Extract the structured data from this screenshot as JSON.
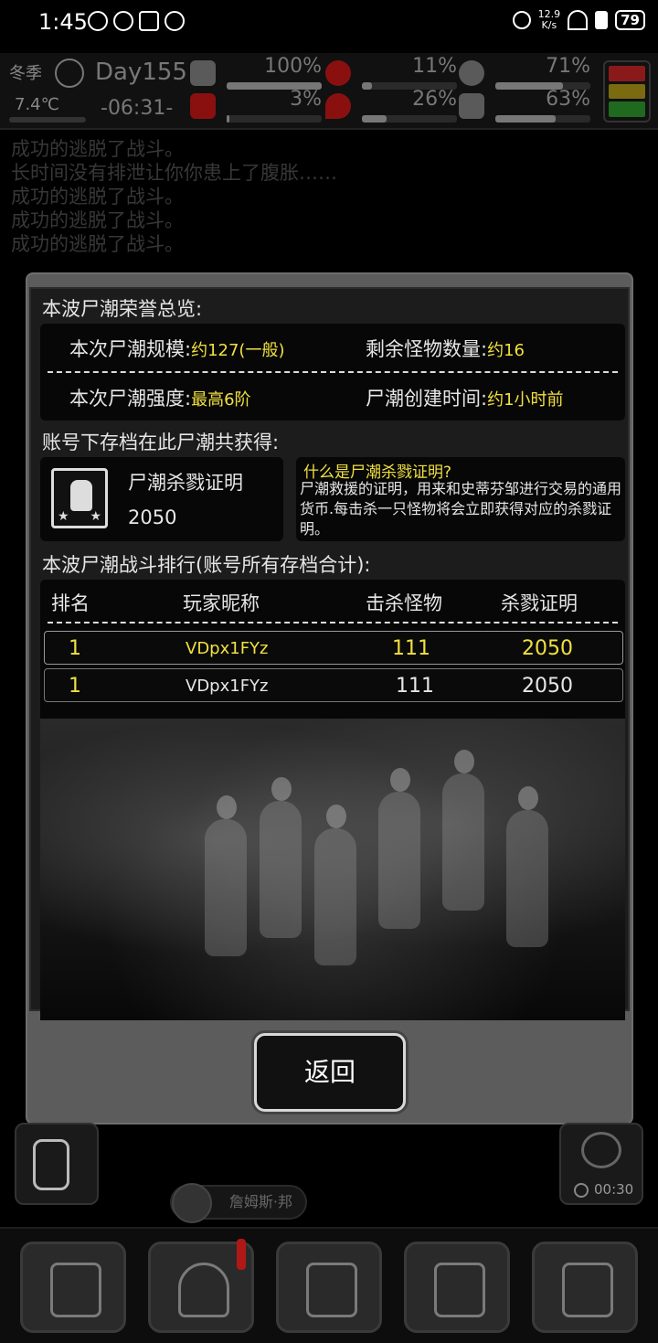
{
  "status_bar": {
    "time": "1:45",
    "net_speed": "12.9",
    "net_unit": "K/s",
    "battery": "79"
  },
  "hud": {
    "season": "冬季",
    "temperature": "7.4℃",
    "day": "Day155",
    "clock": "-06:31-",
    "stats": [
      {
        "name": "health",
        "value": "100%",
        "fill": 1.0
      },
      {
        "name": "hunger",
        "value": "11%",
        "fill": 0.11
      },
      {
        "name": "stamina",
        "value": "71%",
        "fill": 0.71
      },
      {
        "name": "toilet",
        "value": "3%",
        "fill": 0.03
      },
      {
        "name": "thirst",
        "value": "26%",
        "fill": 0.26
      },
      {
        "name": "mood",
        "value": "63%",
        "fill": 0.63
      }
    ],
    "alert_colors": [
      "#8a1a1a",
      "#7a6a10",
      "#1f6a1f"
    ]
  },
  "log": [
    "成功的逃脱了战斗。",
    "长时间没有排泄让你你患上了腹胀……",
    "成功的逃脱了战斗。",
    "成功的逃脱了战斗。",
    "成功的逃脱了战斗。"
  ],
  "modal": {
    "overview_title": "本波尸潮荣誉总览:",
    "scale_label": "本次尸潮规模:",
    "scale_value": "约127(一般)",
    "remaining_label": "剩余怪物数量:",
    "remaining_value": "约16",
    "intensity_label": "本次尸潮强度:",
    "intensity_value": "最高6阶",
    "created_label": "尸潮创建时间:",
    "created_value": "约1小时前",
    "earned_title": "账号下存档在此尸潮共获得:",
    "cert_name": "尸潮杀戮证明",
    "cert_count": "2050",
    "tip_title": "什么是尸潮杀戮证明?",
    "tip_body": "尸潮救援的证明，用来和史蒂芬邹进行交易的通用货币.每击杀一只怪物将会立即获得对应的杀戮证明。",
    "ranking_title": "本波尸潮战斗排行(账号所有存档合计):",
    "columns": [
      "排名",
      "玩家昵称",
      "击杀怪物",
      "杀戮证明"
    ],
    "rows": [
      {
        "rank": "1",
        "name": "VDpx1FYz",
        "kills": "111",
        "certs": "2050",
        "highlight": true
      },
      {
        "rank": "1",
        "name": "VDpx1FYz",
        "kills": "111",
        "certs": "2050",
        "highlight": false
      }
    ],
    "back_label": "返回"
  },
  "bottom": {
    "npc_name": "詹姆斯·邦",
    "radio_timer": "00:30"
  },
  "colors": {
    "accent_yellow": "#f0e040",
    "text_light": "#e6e6e6"
  }
}
